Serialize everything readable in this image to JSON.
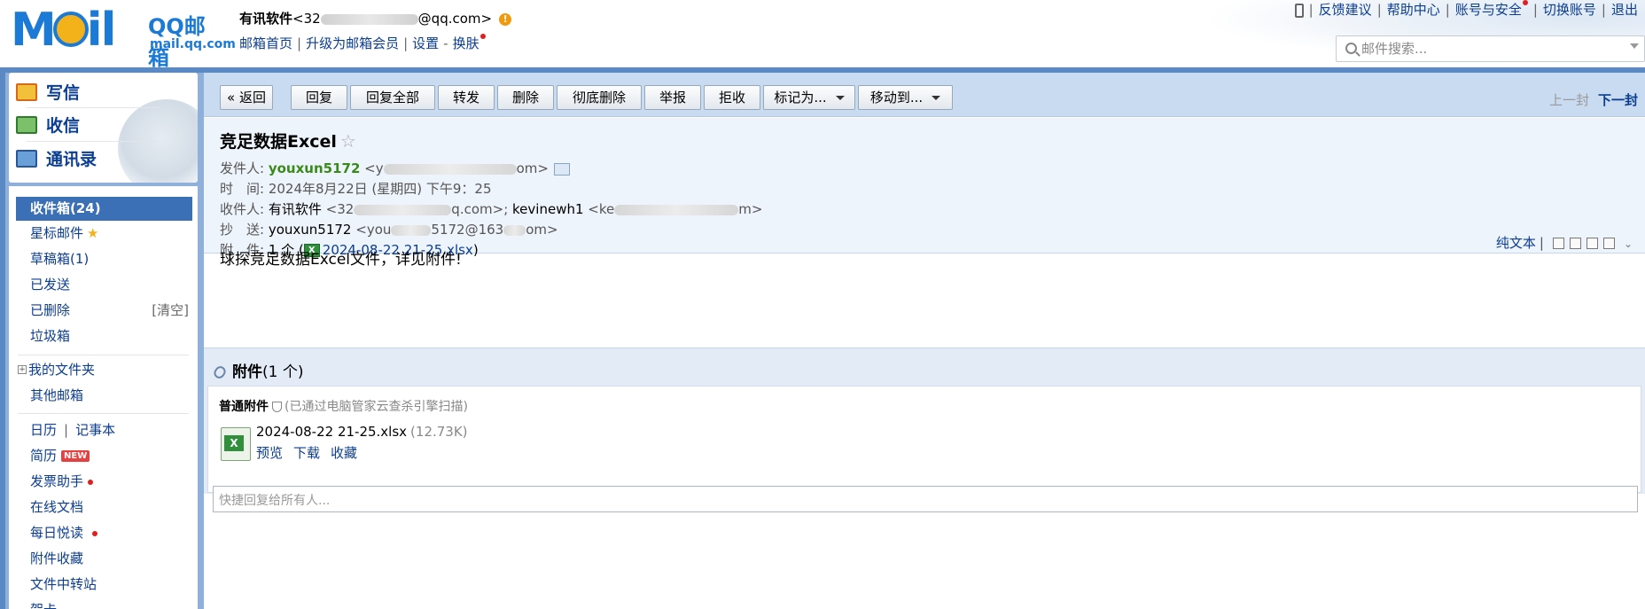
{
  "logo": {
    "brand": "MOil",
    "qq": "QQ邮箱",
    "domain": "mail.qq.com"
  },
  "user": {
    "name": "有讯软件",
    "email_prefix": "<32",
    "email_suffix": "@qq.com>",
    "links": [
      "邮箱首页",
      "升级为邮箱会员",
      "设置",
      "换肤"
    ]
  },
  "top_links": [
    "反馈建议",
    "帮助中心",
    "账号与安全",
    "切换账号",
    "退出"
  ],
  "search": {
    "placeholder": "邮件搜索..."
  },
  "quick": {
    "write": "写信",
    "inbox": "收信",
    "contacts": "通讯录"
  },
  "folders": {
    "inbox": "收件箱(24)",
    "starred": "星标邮件",
    "drafts": "草稿箱(1)",
    "sent": "已发送",
    "deleted": "已删除",
    "clear": "[清空]",
    "spam": "垃圾箱",
    "my_folders": "我的文件夹",
    "other_mail": "其他邮箱",
    "calendar": "日历",
    "notes": "记事本",
    "resume": "简历",
    "new_badge": "NEW",
    "invoice": "发票助手",
    "online_docs": "在线文档",
    "daily": "每日悦读",
    "att_collect": "附件收藏",
    "transfer": "文件中转站",
    "card": "贺卡"
  },
  "toolbar": {
    "back": "« 返回",
    "reply": "回复",
    "reply_all": "回复全部",
    "forward": "转发",
    "delete": "删除",
    "delete_perm": "彻底删除",
    "report": "举报",
    "reject": "拒收",
    "mark_as": "标记为...",
    "move_to": "移动到...",
    "prev": "上一封",
    "next": "下一封"
  },
  "mail": {
    "subject": "竞足数据Excel",
    "from_label": "发件人:",
    "from_name": "youxun5172",
    "from_email_prefix": "<y",
    "from_email_suffix": "om>",
    "time_label": "时　间:",
    "time_value": "2024年8月22日 (星期四) 下午9：25",
    "to_label": "收件人:",
    "to_name1": "有讯软件",
    "to_email1_prefix": "<32",
    "to_email1_suffix": "q.com>;",
    "to_name2": "kevinewh1",
    "to_email2_prefix": "<ke",
    "to_email2_suffix": "m>",
    "cc_label": "抄　送:",
    "cc_name": "youxun5172",
    "cc_email_prefix": "<you",
    "cc_email_mid": "5172@163",
    "cc_email_suffix": "om>",
    "att_label": "附　件:",
    "att_count": "1 个 (",
    "att_link": "2024-08-22 21-25.xlsx",
    "att_close": ")",
    "plain_text": "纯文本",
    "body": "球探竞足数据Excel文件，详见附件!"
  },
  "attachments": {
    "title": "附件",
    "count": "(1 个)",
    "kind": "普通附件",
    "scan": "(已通过电脑管家云查杀引擎扫描)",
    "file_name": "2024-08-22 21-25.xlsx",
    "file_size": "(12.73K)",
    "preview": "预览",
    "download": "下载",
    "collect": "收藏"
  },
  "reply": {
    "placeholder": "快捷回复给所有人..."
  }
}
